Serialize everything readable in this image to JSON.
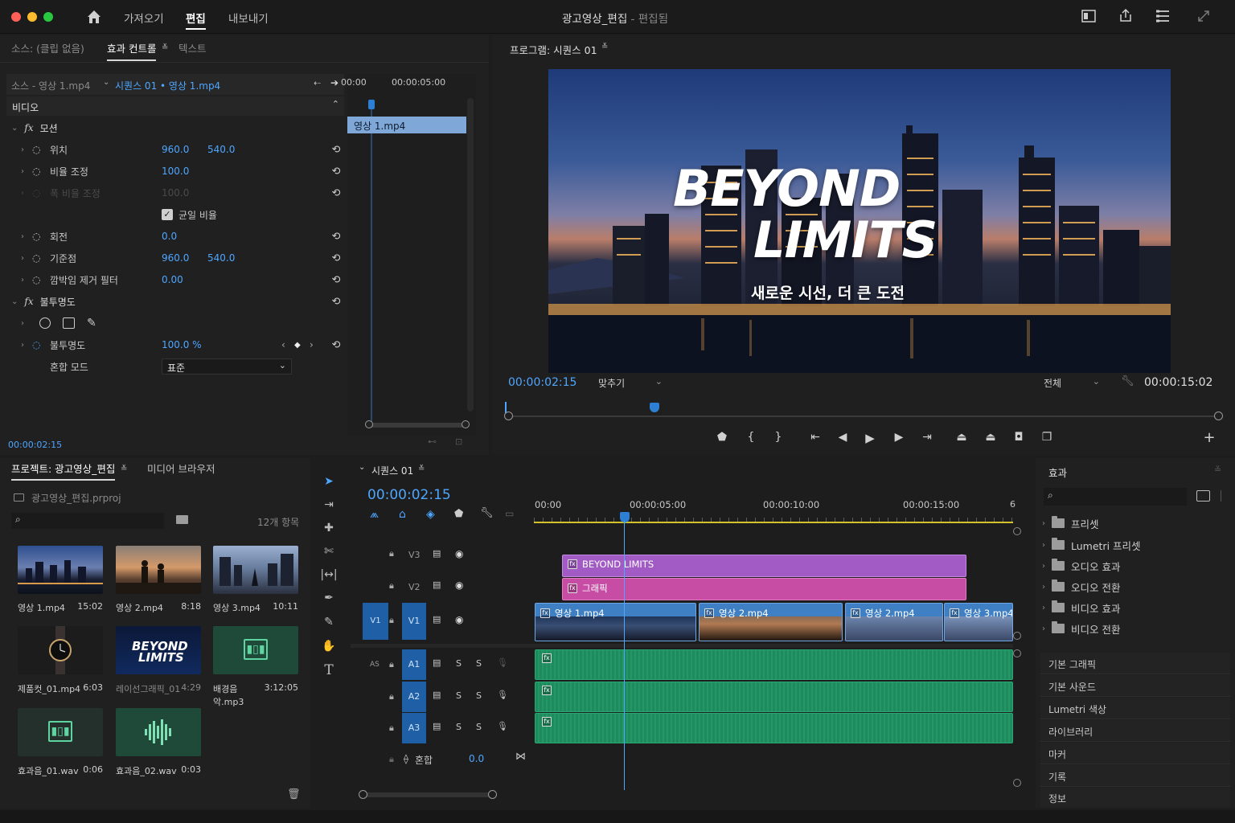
{
  "menu": {
    "home_icon": "home-icon",
    "import": "가져오기",
    "edit": "편집",
    "export": "내보내기"
  },
  "window_title": {
    "main": "광고영상_편집",
    "sep": " - ",
    "sub": "편집됨"
  },
  "effect_controls": {
    "tab_source": "소스: (클립 없음)",
    "tab_effects": "효과 컨트롤",
    "tab_text": "텍스트",
    "source_clip": "소스 - 영상 1.mp4",
    "sequence_clip": "시퀀스 01 • 영상 1.mp4",
    "mini_time_start": "00:00",
    "mini_time_5": "00:00:05:00",
    "mini_clip": "영상 1.mp4",
    "section_video": "비디오",
    "motion": "모션",
    "position_label": "위치",
    "position_x": "960.0",
    "position_y": "540.0",
    "scale_label": "비율 조정",
    "scale_value": "100.0",
    "scale_width_label": "폭 비율 조정",
    "scale_width_value": "100.0",
    "uniform_label": "균일 비율",
    "rotation_label": "회전",
    "rotation_value": "0.0",
    "anchor_label": "기준점",
    "anchor_x": "960.0",
    "anchor_y": "540.0",
    "flicker_label": "깜박임 제거 필터",
    "flicker_value": "0.00",
    "opacity_section": "불투명도",
    "opacity_label": "불투명도",
    "opacity_value": "100.0 %",
    "blend_label": "혼합 모드",
    "blend_value": "표준",
    "timecode": "00:00:02:15"
  },
  "program": {
    "title": "프로그램: 시퀀스 01",
    "headline1": "BEYOND",
    "headline2": "LIMITS",
    "subtitle": "새로운 시선, 더 큰 도전",
    "timecode": "00:00:02:15",
    "fit": "맞추기",
    "quality": "전체",
    "duration": "00:00:15:02"
  },
  "project": {
    "tab_project": "프로젝트: 광고영상_편집",
    "tab_media": "미디어 브라우저",
    "file": "광고영상_편집.prproj",
    "count": "12개 항목",
    "items": [
      {
        "name": "영상 1.mp4",
        "dur": "15:02"
      },
      {
        "name": "영상 2.mp4",
        "dur": "8:18"
      },
      {
        "name": "영상 3.mp4",
        "dur": "10:11"
      },
      {
        "name": "제품컷_01.mp4",
        "dur": "6:03"
      },
      {
        "name": "레이선그래픽_01",
        "dur": "4:29"
      },
      {
        "name": "배경음악.mp3",
        "dur": "3:12:05"
      },
      {
        "name": "효과음_01.wav",
        "dur": "0:06"
      },
      {
        "name": "효과음_02.wav",
        "dur": "0:03"
      }
    ],
    "graphic_text1": "BEYOND",
    "graphic_text2": "LIMITS"
  },
  "timeline": {
    "tab": "시퀀스 01",
    "timecode": "00:00:02:15",
    "ruler": [
      "00:00",
      "00:00:05:00",
      "00:00:10:00",
      "00:00:15:00"
    ],
    "tracks": {
      "v3": "V3",
      "v2": "V2",
      "v1": "V1",
      "v1src": "V1",
      "a1": "A1",
      "a2": "A2",
      "a3": "A3",
      "as": "AS",
      "s": "S",
      "mix": "혼합",
      "mix_value": "0.0"
    },
    "clips": {
      "title": "BEYOND LIMITS",
      "graphic": "그래픽",
      "v1": "영상 1.mp4",
      "v2": "영상 2.mp4",
      "v3": "영상 3.mp4"
    }
  },
  "effects": {
    "title": "효과",
    "folders": [
      "프리셋",
      "Lumetri 프리셋",
      "오디오 효과",
      "오디오 전환",
      "비디오 효과",
      "비디오 전환"
    ],
    "panels": [
      "기본 그래픽",
      "기본 사운드",
      "Lumetri 색상",
      "라이브러리",
      "마커",
      "기록",
      "정보"
    ]
  },
  "colors": {
    "accent": "#4ea6ff",
    "title_clip": "#a25bc4",
    "graphic_clip": "#c74ca4",
    "video_clip": "#3f7fc4",
    "audio_clip": "#1f8a5c",
    "selected_track": "#1f5fa6"
  }
}
